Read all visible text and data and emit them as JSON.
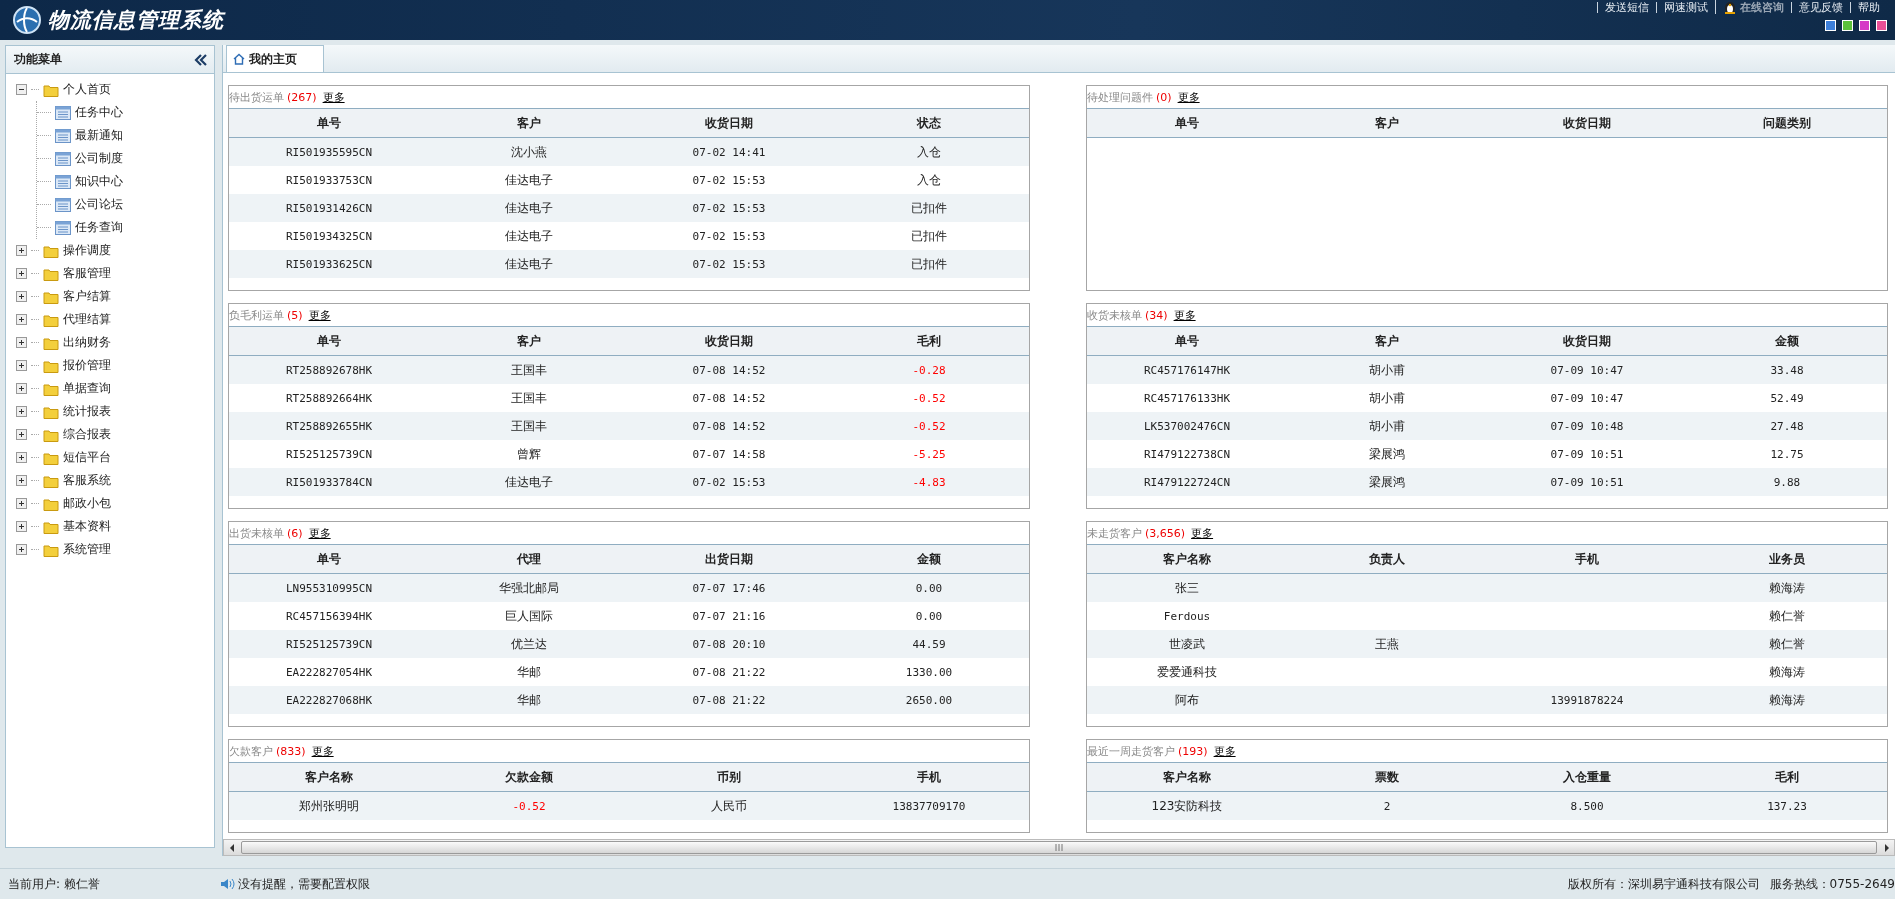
{
  "header": {
    "title": "物流信息管理系统",
    "links": [
      {
        "label": "发送短信",
        "kind": "text"
      },
      {
        "label": "网速测试",
        "kind": "text"
      },
      {
        "label": "在线咨询",
        "kind": "qq"
      },
      {
        "label": "意见反馈",
        "kind": "text"
      },
      {
        "label": "帮助",
        "kind": "text"
      }
    ]
  },
  "sidebar": {
    "title": "功能菜单",
    "items": [
      {
        "label": "个人首页",
        "expanded": true,
        "children": [
          {
            "label": "任务中心"
          },
          {
            "label": "最新通知"
          },
          {
            "label": "公司制度"
          },
          {
            "label": "知识中心"
          },
          {
            "label": "公司论坛"
          },
          {
            "label": "任务查询"
          }
        ]
      },
      {
        "label": "操作调度",
        "expanded": false
      },
      {
        "label": "客服管理",
        "expanded": false
      },
      {
        "label": "客户结算",
        "expanded": false
      },
      {
        "label": "代理结算",
        "expanded": false
      },
      {
        "label": "出纳财务",
        "expanded": false
      },
      {
        "label": "报价管理",
        "expanded": false
      },
      {
        "label": "单据查询",
        "expanded": false
      },
      {
        "label": "统计报表",
        "expanded": false
      },
      {
        "label": "综合报表",
        "expanded": false
      },
      {
        "label": "短信平台",
        "expanded": false
      },
      {
        "label": "客服系统",
        "expanded": false
      },
      {
        "label": "邮政小包",
        "expanded": false
      },
      {
        "label": "基本资料",
        "expanded": false
      },
      {
        "label": "系统管理",
        "expanded": false
      }
    ]
  },
  "tabs": [
    {
      "label": "我的主页",
      "selected": true
    }
  ],
  "panels": [
    {
      "title": "待出货运单",
      "count": "(267)",
      "more": "更多",
      "columns": [
        {
          "label": "单号"
        },
        {
          "label": "客户"
        },
        {
          "label": "收货日期"
        },
        {
          "label": "状态"
        }
      ],
      "rows": [
        [
          "RI501935595CN",
          "沈小燕",
          "07-02 14:41",
          "入仓"
        ],
        [
          "RI501933753CN",
          "佳达电子",
          "07-02 15:53",
          "入仓"
        ],
        [
          "RI501931426CN",
          "佳达电子",
          "07-02 15:53",
          "已扣件"
        ],
        [
          "RI501934325CN",
          "佳达电子",
          "07-02 15:53",
          "已扣件"
        ],
        [
          "RI501933625CN",
          "佳达电子",
          "07-02 15:53",
          "已扣件"
        ]
      ]
    },
    {
      "title": "待处理问题件",
      "count": "(0)",
      "more": "更多",
      "columns": [
        {
          "label": "单号"
        },
        {
          "label": "客户"
        },
        {
          "label": "收货日期"
        },
        {
          "label": "问题类别"
        }
      ]
    },
    {
      "title": "负毛利运单",
      "count": "(5)",
      "more": "更多",
      "columns": [
        {
          "label": "单号"
        },
        {
          "label": "客户"
        },
        {
          "label": "收货日期"
        },
        {
          "label": "毛利",
          "alert": true
        }
      ],
      "rows": [
        [
          "RT258892678HK",
          "王国丰",
          "07-08 14:52",
          "-0.28"
        ],
        [
          "RT258892664HK",
          "王国丰",
          "07-08 14:52",
          "-0.52"
        ],
        [
          "RT258892655HK",
          "王国丰",
          "07-08 14:52",
          "-0.52"
        ],
        [
          "RI525125739CN",
          "曾辉",
          "07-07 14:58",
          "-5.25"
        ],
        [
          "RI501933784CN",
          "佳达电子",
          "07-02 15:53",
          "-4.83"
        ]
      ]
    },
    {
      "title": "收货未核单",
      "count": "(34)",
      "more": "更多",
      "columns": [
        {
          "label": "单号"
        },
        {
          "label": "客户"
        },
        {
          "label": "收货日期"
        },
        {
          "label": "金额"
        }
      ],
      "rows": [
        [
          "RC457176147HK",
          "胡小甫",
          "07-09 10:47",
          "33.48"
        ],
        [
          "RC457176133HK",
          "胡小甫",
          "07-09 10:47",
          "52.49"
        ],
        [
          "LK537002476CN",
          "胡小甫",
          "07-09 10:48",
          "27.48"
        ],
        [
          "RI479122738CN",
          "梁展鸿",
          "07-09 10:51",
          "12.75"
        ],
        [
          "RI479122724CN",
          "梁展鸿",
          "07-09 10:51",
          "9.88"
        ]
      ]
    },
    {
      "title": "出货未核单",
      "count": "(6)",
      "more": "更多",
      "columns": [
        {
          "label": "单号"
        },
        {
          "label": "代理"
        },
        {
          "label": "出货日期"
        },
        {
          "label": "金额"
        }
      ],
      "rows": [
        [
          "LN955310995CN",
          "华强北邮局",
          "07-07 17:46",
          "0.00"
        ],
        [
          "RC457156394HK",
          "巨人国际",
          "07-07 21:16",
          "0.00"
        ],
        [
          "RI525125739CN",
          "优兰达",
          "07-08 20:10",
          "44.59"
        ],
        [
          "EA222827054HK",
          "华邮",
          "07-08 21:22",
          "1330.00"
        ],
        [
          "EA222827068HK",
          "华邮",
          "07-08 21:22",
          "2650.00"
        ]
      ]
    },
    {
      "title": "未走货客户",
      "count": "(3,656)",
      "more": "更多",
      "columns": [
        {
          "label": "客户名称"
        },
        {
          "label": "负责人"
        },
        {
          "label": "手机"
        },
        {
          "label": "业务员"
        }
      ],
      "rows": [
        [
          "张三",
          "",
          "",
          "赖海涛"
        ],
        [
          "Ferdous",
          "",
          "",
          "赖仁誉"
        ],
        [
          "世凌武",
          "王燕",
          "",
          "赖仁誉"
        ],
        [
          "爱爱通科技",
          "",
          "",
          "赖海涛"
        ],
        [
          "阿布",
          "",
          "13991878224",
          "赖海涛"
        ]
      ]
    },
    {
      "title": "欠款客户",
      "count": "(833)",
      "more": "更多",
      "columns": [
        {
          "label": "客户名称"
        },
        {
          "label": "欠款金额",
          "alert": true
        },
        {
          "label": "币别"
        },
        {
          "label": "手机"
        }
      ],
      "rows": [
        [
          "郑州张明明",
          "-0.52",
          "人民币",
          "13837709170"
        ]
      ]
    },
    {
      "title": "最近一周走货客户",
      "count": "(193)",
      "more": "更多",
      "columns": [
        {
          "label": "客户名称"
        },
        {
          "label": "票数"
        },
        {
          "label": "入仓重量"
        },
        {
          "label": "毛利"
        }
      ],
      "rows": [
        [
          "123安防科技",
          "2",
          "8.500",
          "137.23"
        ]
      ]
    }
  ],
  "footer": {
    "user": "当前用户: 赖仁誉",
    "notice": "没有提醒，需要配置权限",
    "copyright": "版权所有：深圳易宇通科技有限公司",
    "hotline": "服务热线：0755-2649"
  }
}
